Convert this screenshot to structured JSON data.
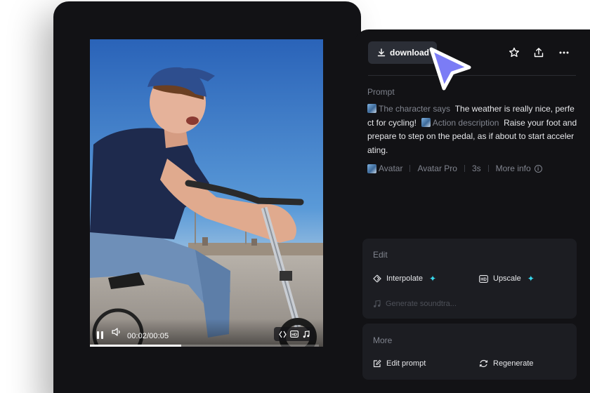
{
  "toolbar": {
    "download_label": "download",
    "icons": [
      "star-icon",
      "share-icon",
      "more-icon"
    ]
  },
  "video": {
    "current_time": "00:02",
    "total_time": "00:05",
    "time_display": "00:02/00:05",
    "progress_fraction": 0.4,
    "tool_icons": [
      "interpolate-icon",
      "hd-icon",
      "music-icon"
    ]
  },
  "prompt": {
    "title": "Prompt",
    "segments": [
      {
        "kind": "tag",
        "text": "The character says"
      },
      {
        "kind": "text",
        "text": "The weather is really nice, perfect for cycling!"
      },
      {
        "kind": "tag",
        "text": "Action description"
      },
      {
        "kind": "text",
        "text": "Raise your foot and prepare to step on the pedal, as if about to start accelerating."
      }
    ],
    "meta": {
      "type": "Avatar",
      "model": "Avatar Pro",
      "duration": "3s",
      "more_info": "More info"
    }
  },
  "edit": {
    "title": "Edit",
    "interpolate": "Interpolate",
    "upscale": "Upscale",
    "soundtrack": "Generate soundtra..."
  },
  "more": {
    "title": "More",
    "edit_prompt": "Edit prompt",
    "regenerate": "Regenerate"
  },
  "colors": {
    "background": "#121215",
    "card": "#1c1d22",
    "button": "#2b2e36",
    "accent_sparkle": "#38d9ee",
    "cursor": "#7b7cf5"
  }
}
